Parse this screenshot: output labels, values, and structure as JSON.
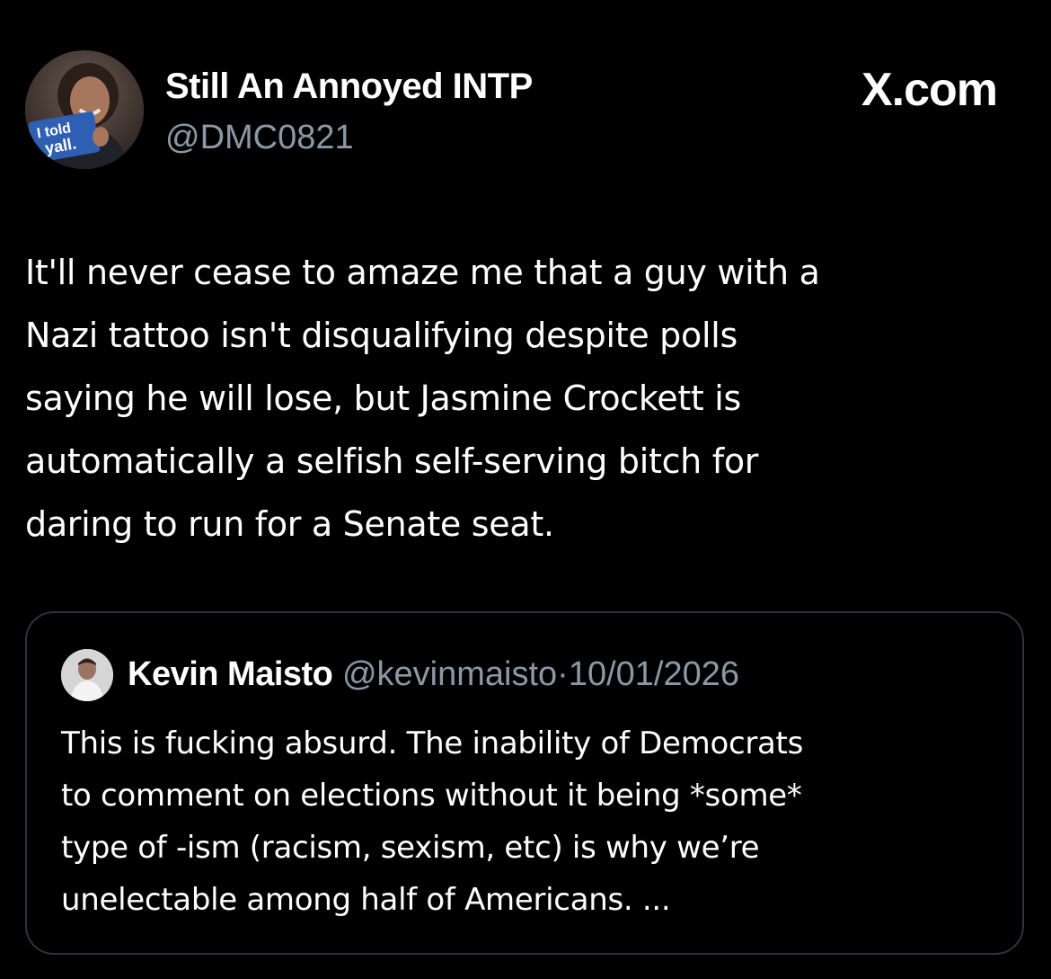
{
  "tweet": {
    "author_name": "Still An Annoyed INTP",
    "author_handle": "@DMC0821",
    "avatar_sign_text": "I told y'all.",
    "brand": "X.com",
    "text_lines": [
      "It'll never cease to amaze me that a guy with a",
      "Nazi tattoo isn't disqualifying despite polls",
      "saying he will lose, but Jasmine Crockett is",
      "automatically a selfish self-serving bitch for",
      "daring to run for a Senate seat."
    ]
  },
  "quote": {
    "author_name": "Kevin Maisto",
    "author_handle": "@kevinmaisto",
    "separator": "·",
    "date": "10/01/2026",
    "text_lines": [
      "This is fucking absurd. The inability of Democrats",
      "to comment on elections without it being *some*",
      "type of -ism (racism, sexism, etc) is why we’re",
      "unelectable among half of Americans. ..."
    ]
  },
  "colors": {
    "background": "#000000",
    "primary_text": "#ffffff",
    "secondary_text": "#8b98a5",
    "card_border": "#2f3336",
    "sign_blue": "#2f5fb3"
  }
}
